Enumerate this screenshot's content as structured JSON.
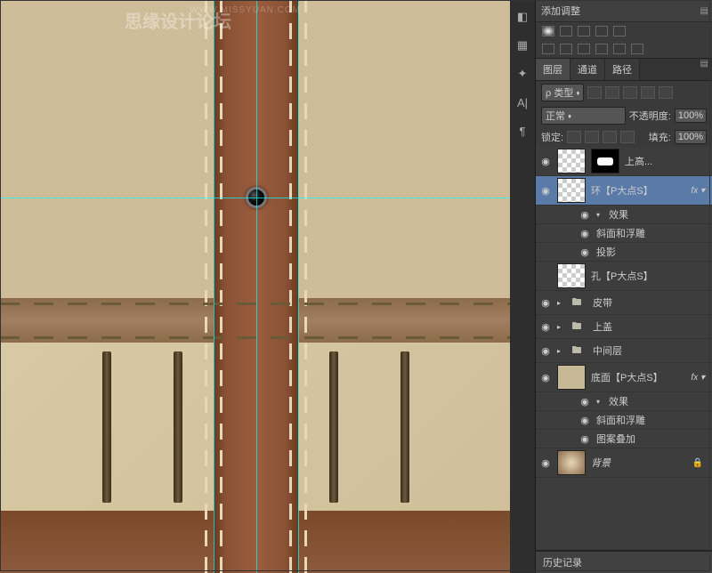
{
  "watermark": "思缘设计论坛",
  "url": "WWW.MISSYUAN.COM",
  "adjustments": {
    "title": "添加调整"
  },
  "layers_panel": {
    "tabs": [
      "图层",
      "通道",
      "路径"
    ],
    "active_tab": 0,
    "filter_label": "ρ 类型",
    "blend_mode": "正常",
    "opacity_label": "不透明度:",
    "opacity_value": "100%",
    "lock_label": "锁定:",
    "fill_label": "填充:",
    "fill_value": "100%",
    "layers": [
      {
        "eye": true,
        "thumb": "checker",
        "mask": true,
        "name": "上高...",
        "fx": false
      },
      {
        "eye": true,
        "thumb": "checker",
        "name": "环【P大点S】",
        "fx": true,
        "selected": true,
        "effects": [
          "效果",
          "斜面和浮雕",
          "投影"
        ]
      },
      {
        "eye": false,
        "thumb": "checker",
        "name": "孔【P大点S】",
        "fx": false
      },
      {
        "eye": true,
        "group": true,
        "name": "皮带"
      },
      {
        "eye": true,
        "group": true,
        "name": "上盖"
      },
      {
        "eye": true,
        "group": true,
        "name": "中间层"
      },
      {
        "eye": true,
        "thumb": "fill",
        "name": "底面【P大点S】",
        "fx": true,
        "effects": [
          "效果",
          "斜面和浮雕",
          "图案叠加"
        ]
      },
      {
        "eye": true,
        "thumb": "grad",
        "name": "背景",
        "locked": true
      }
    ]
  },
  "history": {
    "title": "历史记录"
  },
  "icons": {
    "histogram": "⬚",
    "swatches": "▦",
    "brush": "✦",
    "text": "A|",
    "para": "¶",
    "eye": "◉",
    "triangle_down": "▾",
    "triangle_right": "▸",
    "folder": "▶ ▮",
    "menu": "▤",
    "arrows": "✥",
    "lock": "🔒"
  }
}
